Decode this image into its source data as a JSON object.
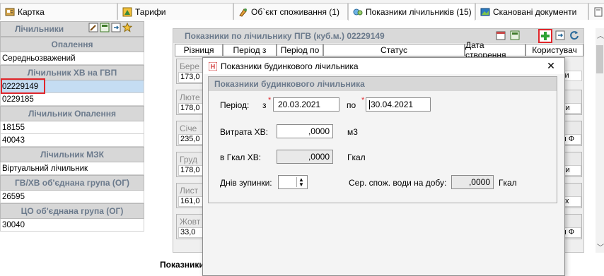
{
  "tabs": [
    {
      "label": "Картка",
      "icon": "card-icon"
    },
    {
      "label": "Тарифи",
      "icon": "tariff-icon"
    },
    {
      "label": "Об`єкт споживання (1)",
      "icon": "object-icon"
    },
    {
      "label": "Показники лічильників (15)",
      "icon": "meters-icon"
    },
    {
      "label": "Скановані документи",
      "icon": "scan-icon"
    }
  ],
  "left_panel": {
    "title": "Лічильники",
    "sections": [
      {
        "header": "Опалення",
        "rows": [
          "Середньозважений"
        ]
      },
      {
        "header": "Лічильник ХВ на ГВП",
        "rows": [
          "02229149",
          "0229185"
        ]
      },
      {
        "header": "Лічильник Опалення",
        "rows": [
          "18155",
          "40043"
        ]
      },
      {
        "header": "Лічильник МЗК",
        "rows": [
          "Віртуальний лічильник"
        ]
      },
      {
        "header": "ГВ/ХВ об'єднана група (ОГ)",
        "rows": [
          "26595"
        ]
      },
      {
        "header": "ЦО об'єднана група (ОГ)",
        "rows": [
          "30040"
        ]
      }
    ]
  },
  "center": {
    "title": "Показники по лічильнику ПГВ (куб.м.) 02229149",
    "columns": [
      "Різниця",
      "Період з",
      "Період по",
      "Статус",
      "Дата створення",
      "Користувач"
    ],
    "groups": [
      {
        "label": "Бере",
        "value": "173,0",
        "user": "ана Ми"
      },
      {
        "label": "Люте",
        "value": "178,0",
        "user": "ана Ми"
      },
      {
        "label": "Січе",
        "value": "235,0",
        "user": "аталія Ф"
      },
      {
        "label": "Груд",
        "value": "178,0",
        "user": "ана Ми"
      },
      {
        "label": "Лист",
        "value": "161,0",
        "user": "са Мих"
      },
      {
        "label": "Жовт",
        "value": "33,0",
        "user": "аталія Ф"
      }
    ],
    "bottom_tab": "Показники"
  },
  "dialog": {
    "title": "Показники будинкового лічильника",
    "fieldset_title": "Показники будинкового лічильника",
    "period_label": "Період:",
    "from_label": "з",
    "from_value": "20.03.2021",
    "to_label": "по",
    "to_value": "30.04.2021",
    "consumption_label": "Витрата ХВ:",
    "consumption_value": ",0000",
    "consumption_unit": "м3",
    "gcal_label": "в Гкал ХВ:",
    "gcal_value": ",0000",
    "gcal_unit": "Гкал",
    "stop_days_label": "Днів зупинки:",
    "stop_days_value": "",
    "avg_label": "Сер. спож. води на добу:",
    "avg_value": ",0000",
    "avg_unit": "Гкал",
    "required_mark": "*",
    "close_glyph": "✕"
  },
  "colors": {
    "highlight": "#e0262b",
    "selected_row": "#c5ddf3",
    "header_text": "#6b7a8c"
  }
}
